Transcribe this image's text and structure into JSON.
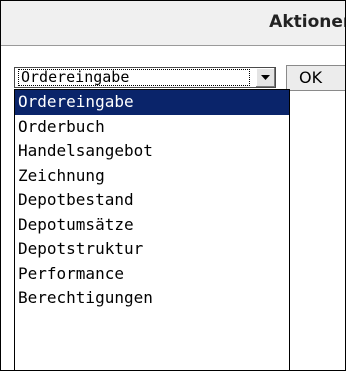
{
  "header": {
    "title": "Aktionen"
  },
  "action_select": {
    "selected": "Ordereingabe",
    "options": [
      {
        "label": "Ordereingabe",
        "selected": true
      },
      {
        "label": "Orderbuch",
        "selected": false
      },
      {
        "label": "Handelsangebot",
        "selected": false
      },
      {
        "label": "Zeichnung",
        "selected": false
      },
      {
        "label": "Depotbestand",
        "selected": false
      },
      {
        "label": "Depotumsätze",
        "selected": false
      },
      {
        "label": "Depotstruktur",
        "selected": false
      },
      {
        "label": "Performance",
        "selected": false
      },
      {
        "label": "Berechtigungen",
        "selected": false
      }
    ]
  },
  "ok_button": {
    "label": "OK"
  },
  "colors": {
    "selection_bg": "#0a246a",
    "selection_text": "#ffffff",
    "header_bg": "#f0f0f0"
  },
  "icons": {
    "dropdown_arrow": "chevron-down-icon"
  }
}
